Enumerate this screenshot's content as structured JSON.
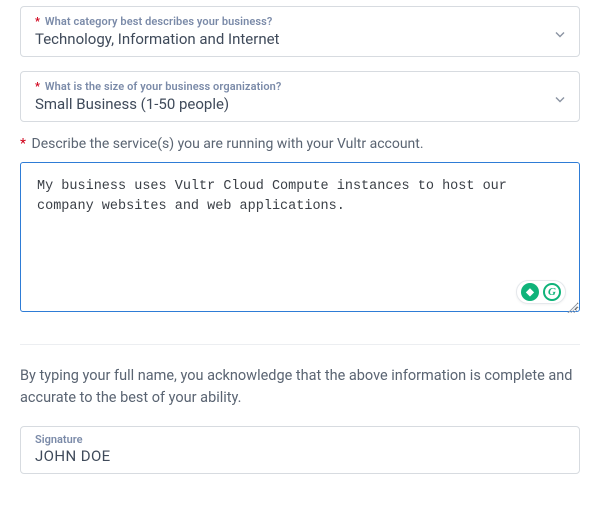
{
  "category": {
    "label": "What category best describes your business?",
    "value": "Technology, Information and Internet"
  },
  "size": {
    "label": "What is the size of your business organization?",
    "value": "Small Business (1-50 people)"
  },
  "services": {
    "label": "Describe the service(s) you are running with your Vultr account.",
    "value": "My business uses Vultr Cloud Compute instances to host our company websites and web applications."
  },
  "ack_text": "By typing your full name, you acknowledge that the above information is complete and accurate to the best of your ability.",
  "signature": {
    "label": "Signature",
    "value": "JOHN DOE"
  },
  "asterisk": "*"
}
